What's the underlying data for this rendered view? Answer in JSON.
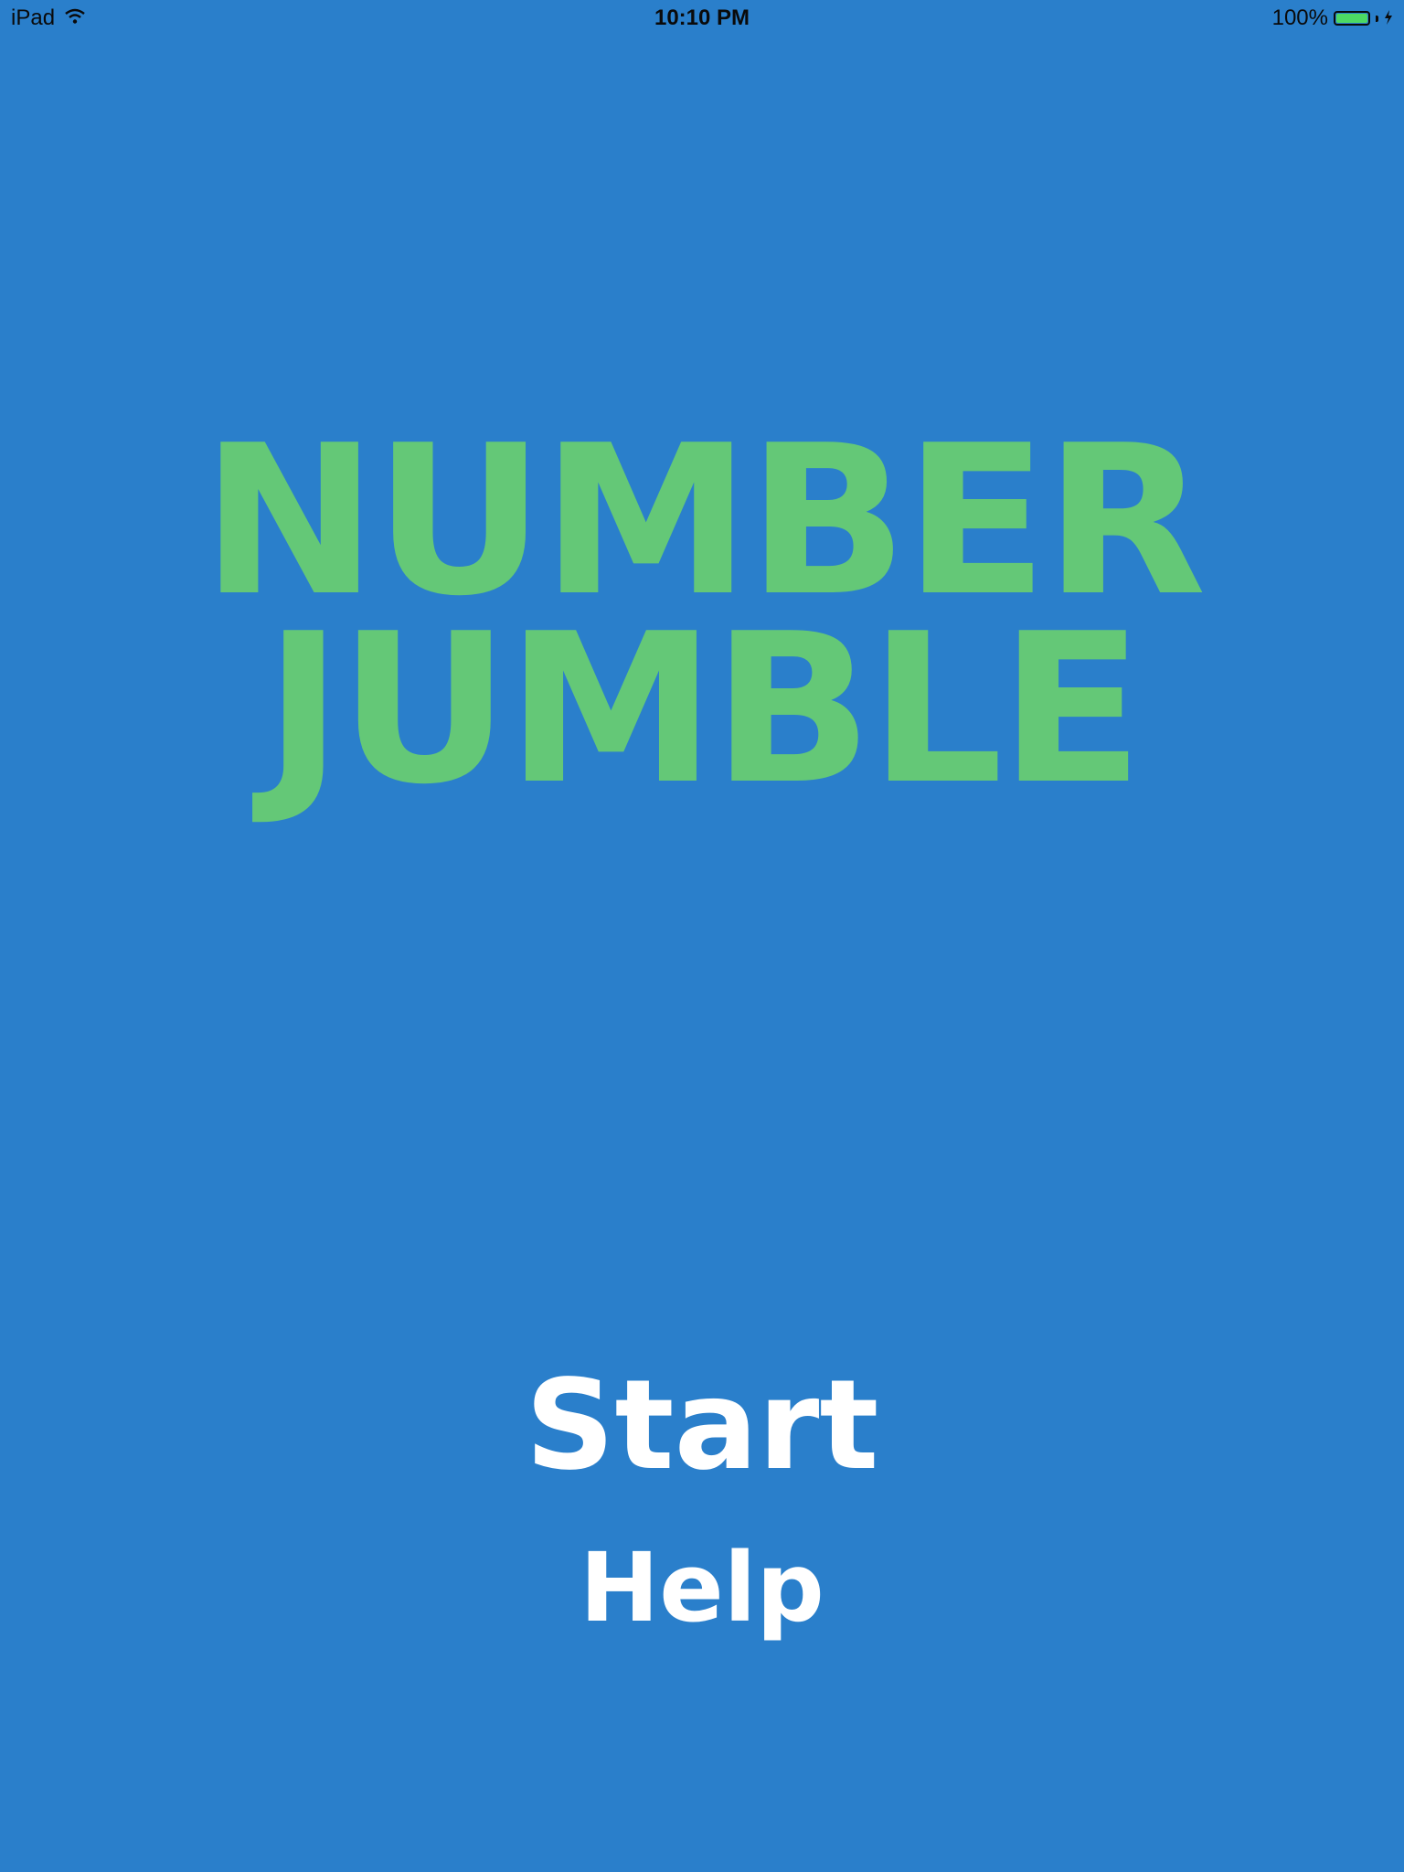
{
  "status_bar": {
    "device": "iPad",
    "wifi_icon": "wifi-icon",
    "time": "10:10 PM",
    "battery_percent": "100%",
    "battery_level": 1.0,
    "battery_icon": "battery-icon",
    "charging_icon": "charging-bolt-icon"
  },
  "colors": {
    "background": "#2a7fcb",
    "title": "#64c877",
    "menu_text": "#ffffff",
    "battery_fill": "#4cd964"
  },
  "title": {
    "line1": "NUMBER",
    "line2": "JUMBLE"
  },
  "menu": {
    "start_label": "Start",
    "help_label": "Help"
  }
}
